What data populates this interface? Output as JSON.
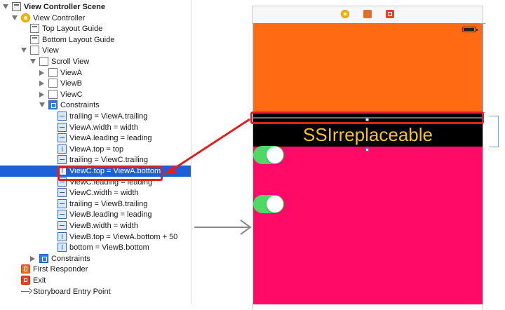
{
  "outline": {
    "rows": [
      {
        "label": "View Controller Scene",
        "indent": 0,
        "tri": "down",
        "icon": "scene",
        "bold": true
      },
      {
        "label": "View Controller",
        "indent": 1,
        "tri": "down",
        "icon": "vc"
      },
      {
        "label": "Top Layout Guide",
        "indent": 2,
        "tri": "",
        "icon": "guide"
      },
      {
        "label": "Bottom Layout Guide",
        "indent": 2,
        "tri": "",
        "icon": "guide"
      },
      {
        "label": "View",
        "indent": 2,
        "tri": "down",
        "icon": "view"
      },
      {
        "label": "Scroll View",
        "indent": 3,
        "tri": "down",
        "icon": "view"
      },
      {
        "label": "ViewA",
        "indent": 4,
        "tri": "right",
        "icon": "view"
      },
      {
        "label": "ViewB",
        "indent": 4,
        "tri": "right",
        "icon": "view"
      },
      {
        "label": "ViewC",
        "indent": 4,
        "tri": "right",
        "icon": "view"
      },
      {
        "label": "Constraints",
        "indent": 4,
        "tri": "down",
        "icon": "cgroup"
      },
      {
        "label": "trailing = ViewA.trailing",
        "indent": 5,
        "tri": "",
        "icon": "cons"
      },
      {
        "label": "ViewA.width = width",
        "indent": 5,
        "tri": "",
        "icon": "cons"
      },
      {
        "label": "ViewA.leading = leading",
        "indent": 5,
        "tri": "",
        "icon": "cons"
      },
      {
        "label": "ViewA.top = top",
        "indent": 5,
        "tri": "",
        "icon": "cons-v"
      },
      {
        "label": "trailing = ViewC.trailing",
        "indent": 5,
        "tri": "",
        "icon": "cons"
      },
      {
        "label": "ViewC.top = ViewA.bottom",
        "indent": 5,
        "tri": "",
        "icon": "cons-v",
        "selected": true
      },
      {
        "label": "ViewC.leading = leading",
        "indent": 5,
        "tri": "",
        "icon": "cons"
      },
      {
        "label": "ViewC.width = width",
        "indent": 5,
        "tri": "",
        "icon": "cons"
      },
      {
        "label": "trailing = ViewB.trailing",
        "indent": 5,
        "tri": "",
        "icon": "cons"
      },
      {
        "label": "ViewB.leading = leading",
        "indent": 5,
        "tri": "",
        "icon": "cons"
      },
      {
        "label": "ViewB.width = width",
        "indent": 5,
        "tri": "",
        "icon": "cons"
      },
      {
        "label": "ViewB.top = ViewA.bottom + 50",
        "indent": 5,
        "tri": "",
        "icon": "cons-v"
      },
      {
        "label": "bottom = ViewB.bottom",
        "indent": 5,
        "tri": "",
        "icon": "cons-v"
      },
      {
        "label": "Constraints",
        "indent": 3,
        "tri": "right",
        "icon": "cgroup"
      },
      {
        "label": "First Responder",
        "indent": 1,
        "tri": "",
        "icon": "fr"
      },
      {
        "label": "Exit",
        "indent": 1,
        "tri": "",
        "icon": "exit"
      },
      {
        "label": "Storyboard Entry Point",
        "indent": 1,
        "tri": "",
        "icon": "arrow"
      }
    ]
  },
  "canvas": {
    "scene_bar_icons": [
      "view-controller-icon",
      "first-responder-icon",
      "exit-icon"
    ],
    "viewC_label": "SSIrreplaceable",
    "switch_states": [
      true,
      true
    ]
  },
  "colors": {
    "viewA": "#ff6a12",
    "viewB": "#000000",
    "viewC_text": "#f2c034",
    "pink_view": "#ff0a66",
    "switch_on": "#4cd964",
    "selection": "#1d5fd6",
    "highlight": "#e02020"
  }
}
